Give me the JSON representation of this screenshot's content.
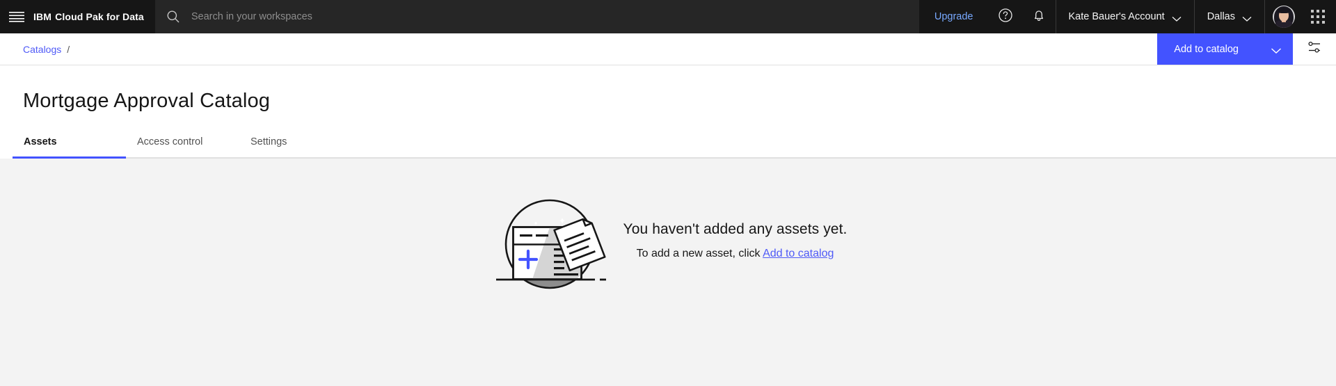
{
  "header": {
    "menu_icon": "hamburger-menu-icon",
    "brand_ibm": "IBM",
    "brand_product": "Cloud Pak for Data",
    "search": {
      "icon": "search-icon",
      "placeholder": "Search in your workspaces",
      "value": ""
    },
    "upgrade_label": "Upgrade",
    "help_icon": "help-question-icon",
    "notifications_icon": "bell-icon",
    "account_label": "Kate Bauer's Account",
    "account_chevron_icon": "chevron-down-icon",
    "region_label": "Dallas",
    "region_chevron_icon": "chevron-down-icon",
    "avatar_icon": "user-avatar",
    "app_switcher_icon": "app-switcher-grid-icon"
  },
  "subbar": {
    "breadcrumb_link": "Catalogs",
    "breadcrumb_separator": "/",
    "add_to_catalog_label": "Add to catalog",
    "add_chevron_icon": "chevron-down-icon",
    "settings_icon": "manage-columns-icon"
  },
  "page": {
    "title": "Mortgage Approval Catalog",
    "tabs": [
      {
        "label": "Assets",
        "active": true
      },
      {
        "label": "Access control",
        "active": false
      },
      {
        "label": "Settings",
        "active": false
      }
    ]
  },
  "empty_state": {
    "illustration_icon": "empty-assets-illustration",
    "title": "You haven't added any assets yet.",
    "subtitle_prefix": "To add a new asset, click ",
    "subtitle_link": "Add to catalog"
  },
  "colors": {
    "header_bg": "#161616",
    "search_bg": "#262626",
    "accent_blue": "#4353ff",
    "link_blue": "#4f5af7",
    "upgrade_blue": "#78a9ff",
    "content_bg": "#f3f3f3"
  }
}
